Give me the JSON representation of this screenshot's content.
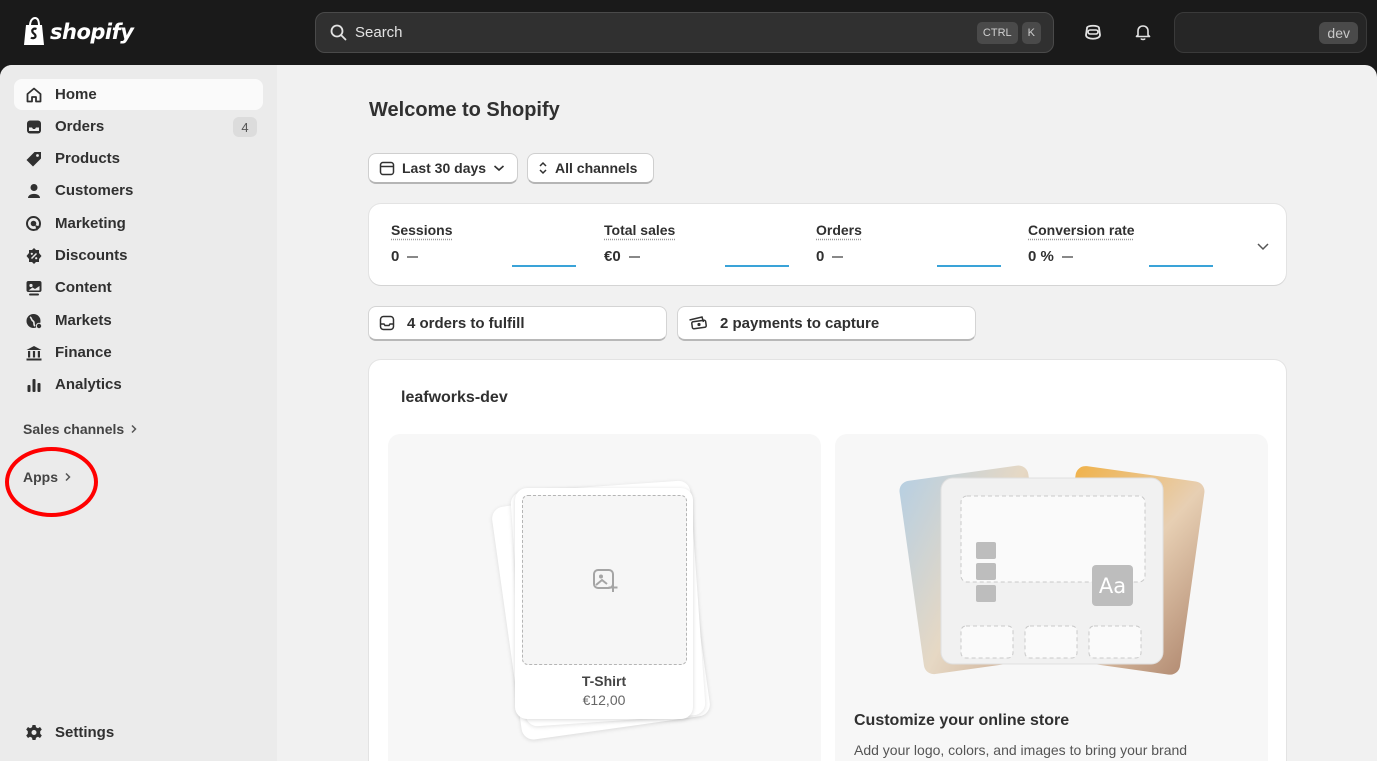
{
  "topbar": {
    "logo_text": "shopify",
    "search_label": "Search",
    "shortcut_keys": [
      "CTRL",
      "K"
    ],
    "store_badge": "dev"
  },
  "sidebar": {
    "items": [
      {
        "label": "Home",
        "icon": "home-icon",
        "active": true
      },
      {
        "label": "Orders",
        "icon": "inbox-icon",
        "count": "4"
      },
      {
        "label": "Products",
        "icon": "tag-icon"
      },
      {
        "label": "Customers",
        "icon": "person-icon"
      },
      {
        "label": "Marketing",
        "icon": "target-icon"
      },
      {
        "label": "Discounts",
        "icon": "discount-icon"
      },
      {
        "label": "Content",
        "icon": "content-icon"
      },
      {
        "label": "Markets",
        "icon": "globe-icon"
      },
      {
        "label": "Finance",
        "icon": "bank-icon"
      },
      {
        "label": "Analytics",
        "icon": "bar-chart-icon"
      }
    ],
    "sales_channels_label": "Sales channels",
    "apps_label": "Apps",
    "settings_label": "Settings"
  },
  "main": {
    "title": "Welcome to Shopify",
    "date_filter": "Last 30 days",
    "channel_filter": "All channels",
    "metrics": [
      {
        "label": "Sessions",
        "value": "0"
      },
      {
        "label": "Total sales",
        "value": "€0"
      },
      {
        "label": "Orders",
        "value": "0"
      },
      {
        "label": "Conversion rate",
        "value": "0 %"
      }
    ],
    "tasks": [
      {
        "label": "4 orders to fulfill",
        "icon": "inbox-icon"
      },
      {
        "label": "2 payments to capture",
        "icon": "cash-icon"
      }
    ],
    "store_name": "leafworks-dev",
    "product_name": "T-Shirt",
    "product_price": "€12,00",
    "theme_preview_text": "Aa",
    "theme_title": "Customize your online store",
    "theme_desc": "Add your logo, colors, and images to bring your brand"
  }
}
